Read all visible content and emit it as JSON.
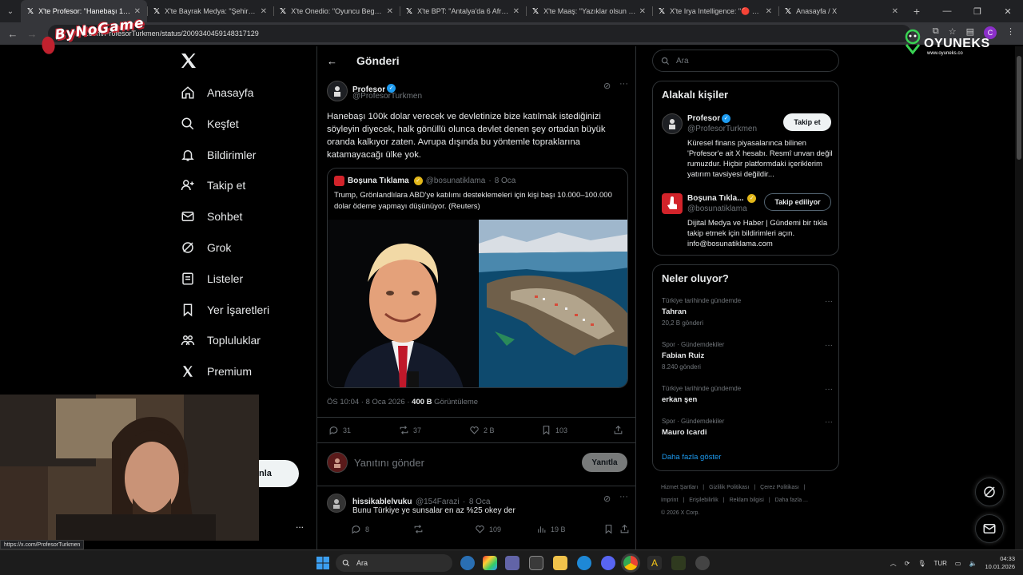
{
  "browser": {
    "tabs": [
      {
        "title": "X'te Profesor: \"Hanebaşı 100k d",
        "active": true
      },
      {
        "title": "X'te Bayrak Medya: \"Şehir Hastan",
        "active": false
      },
      {
        "title": "X'te Onedio: \"Oyuncu Begüm Ö",
        "active": false
      },
      {
        "title": "X'te BPT: \"Antalya'da 6 Afrika k",
        "active": false
      },
      {
        "title": "X'te Maaş: \"Yazıklar olsun böyle",
        "active": false
      },
      {
        "title": "X'te Irya Intelligence: \"🔴 Sosy",
        "active": false
      },
      {
        "title": "Anasayfa / X",
        "active": false
      }
    ],
    "url": "x.com/ProfesorTurkmen/status/2009340459148317129",
    "status_url": "https://x.com/ProfesorTurkmen",
    "profile_letter": "C"
  },
  "overlays": {
    "left_logo": "ByNoGame",
    "right_logo": "OYUNEKS",
    "right_logo_sub": "www.oyuneks.co"
  },
  "nav": {
    "items": [
      {
        "key": "home",
        "label": "Anasayfa"
      },
      {
        "key": "explore",
        "label": "Keşfet"
      },
      {
        "key": "notifications",
        "label": "Bildirimler"
      },
      {
        "key": "follow",
        "label": "Takip et"
      },
      {
        "key": "chat",
        "label": "Sohbet"
      },
      {
        "key": "grok",
        "label": "Grok"
      },
      {
        "key": "lists",
        "label": "Listeler"
      },
      {
        "key": "bookmarks",
        "label": "Yer İşaretleri"
      },
      {
        "key": "communities",
        "label": "Topluluklar"
      },
      {
        "key": "premium",
        "label": "Premium"
      }
    ],
    "post_button_partial": "nla",
    "more": "..."
  },
  "main": {
    "header_title": "Gönderi",
    "tweet": {
      "name": "Profesor",
      "handle": "@ProfesorTurkmen",
      "text": "Hanebaşı 100k dolar verecek ve devletinize bize katılmak istediğinizi söyleyin diyecek, halk gönüllü olunca devlet denen şey ortadan büyük oranda kalkıyor zaten. Avrupa dışında bu yöntemle topraklarına katamayacağı ülke yok.",
      "quote": {
        "name": "Boşuna Tıklama",
        "handle": "@bosunatiklama",
        "date": "8 Oca",
        "text": "Trump, Grönlandlılara ABD'ye katılımı desteklemeleri için kişi başı 10.000–100.000 dolar ödeme yapmayı düşünüyor. (Reuters)"
      },
      "time": "ÖS 10:04 · 8 Oca 2026 · ",
      "views": "400 B",
      "views_label": " Görüntüleme",
      "stats": {
        "replies": "31",
        "reposts": "37",
        "likes": "2 B",
        "bookmarks": "103"
      }
    },
    "reply_placeholder": "Yanıtını gönder",
    "reply_button": "Yanıtla",
    "reply": {
      "name": "hissikablelvuku",
      "handle": "@154Farazi",
      "date": "8 Oca",
      "text": "Bunu Türkiye ye sunsalar en az %25 okey der",
      "stats": {
        "replies": "8",
        "likes": "109",
        "views": "19 B"
      }
    }
  },
  "sidebar": {
    "search_placeholder": "Ara",
    "relevant_title": "Alakalı kişiler",
    "people": [
      {
        "name": "Profesor",
        "handle": "@ProfesorTurkmen",
        "button": "Takip et",
        "bio": "Küresel finans piyasalarınca bilinen 'Profesor'e ait X hesabı. Resmî unvan değil rumuzdur. Hiçbir platformdaki içeriklerim yatırım tavsiyesi değildir..."
      },
      {
        "name": "Boşuna Tıkla...",
        "handle": "@bosunatiklama",
        "button": "Takip ediliyor",
        "bio": "Dijital Medya ve Haber | Gündemi bir tıkla takip etmek için bildirimleri açın. info@bosunatiklama.com"
      }
    ],
    "trends_title": "Neler oluyor?",
    "trends": [
      {
        "context": "Türkiye tarihinde gündemde",
        "name": "Tahran",
        "count": "20,2 B gönderi"
      },
      {
        "context": "Spor · Gündemdekiler",
        "name": "Fabian Ruiz",
        "count": "8.240 gönderi"
      },
      {
        "context": "Türkiye tarihinde gündemde",
        "name": "erkan şen",
        "count": ""
      },
      {
        "context": "Spor · Gündemdekiler",
        "name": "Mauro Icardi",
        "count": ""
      }
    ],
    "show_more": "Daha fazla göster",
    "footer": [
      "Hizmet Şartları",
      "|",
      "Gizlilik Politikası",
      "|",
      "Çerez Politikası",
      "|",
      "Imprint",
      "|",
      "Erişilebilirlik",
      "|",
      "Reklam bilgisi",
      "|",
      "Daha fazla ...",
      "© 2026 X Corp."
    ]
  },
  "taskbar": {
    "search_label": "Ara",
    "lang": "TUR",
    "time": "04:33",
    "date": "10.01.2026"
  },
  "colors": {
    "accent": "#1d9bf0",
    "bg": "#000000",
    "border": "#2f3336",
    "muted": "#71767b"
  }
}
